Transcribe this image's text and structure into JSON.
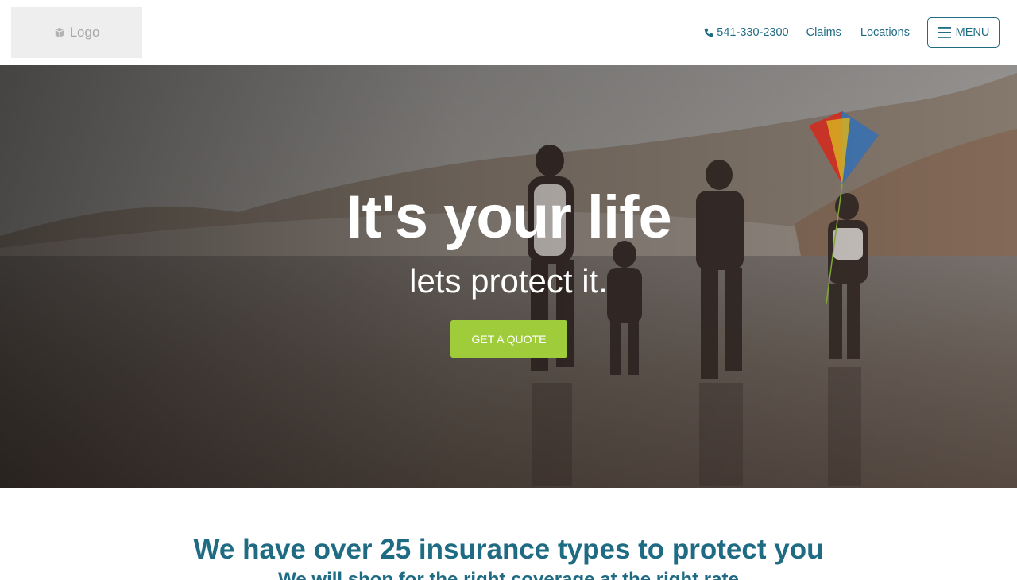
{
  "header": {
    "logo_text": "Logo",
    "phone": "541-330-2300",
    "claims_label": "Claims",
    "locations_label": "Locations",
    "menu_label": "MENU"
  },
  "hero": {
    "title": "It's your life",
    "subtitle": "lets protect it.",
    "cta_label": "GET A QUOTE"
  },
  "section": {
    "title": "We have over 25 insurance types to protect you",
    "subtitle": "We will shop for the right coverage at the right rate"
  },
  "colors": {
    "brand": "#1f6b84",
    "cta": "#9fcc3b",
    "logo_bg": "#eeeeee"
  },
  "icons": [
    "cube-icon",
    "phone-icon",
    "hamburger-icon"
  ]
}
